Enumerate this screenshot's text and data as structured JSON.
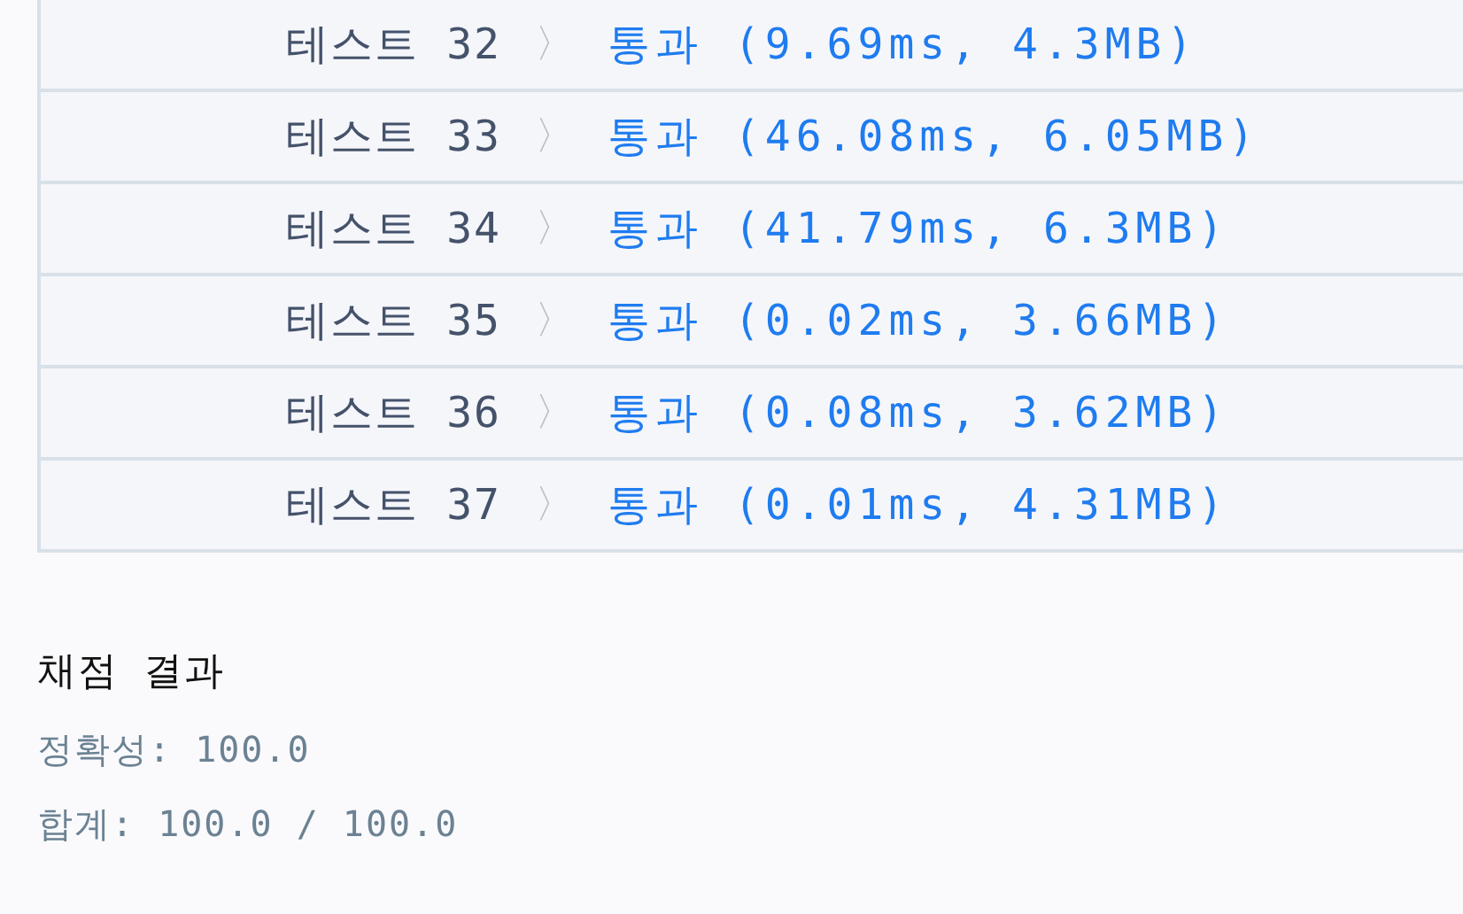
{
  "tests": [
    {
      "label": "테스트 32",
      "chevron": "〉",
      "status": "통과",
      "detail": "(9.69ms, 4.3MB)"
    },
    {
      "label": "테스트 33",
      "chevron": "〉",
      "status": "통과",
      "detail": "(46.08ms, 6.05MB)"
    },
    {
      "label": "테스트 34",
      "chevron": "〉",
      "status": "통과",
      "detail": "(41.79ms, 6.3MB)"
    },
    {
      "label": "테스트 35",
      "chevron": "〉",
      "status": "통과",
      "detail": "(0.02ms, 3.66MB)"
    },
    {
      "label": "테스트 36",
      "chevron": "〉",
      "status": "통과",
      "detail": "(0.08ms, 3.62MB)"
    },
    {
      "label": "테스트 37",
      "chevron": "〉",
      "status": "통과",
      "detail": "(0.01ms, 4.31MB)"
    }
  ],
  "result": {
    "title": "채점 결과",
    "lines": [
      "정확성: 100.0",
      "합계: 100.0 / 100.0"
    ]
  }
}
